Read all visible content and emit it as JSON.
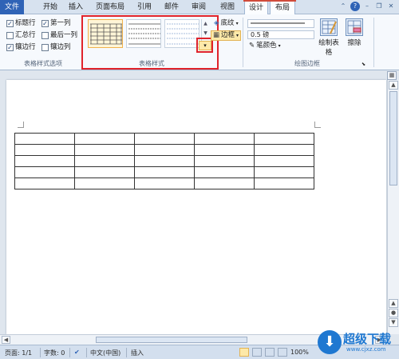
{
  "tabs": [
    {
      "label": "文件"
    },
    {
      "label": "开始"
    },
    {
      "label": "插入"
    },
    {
      "label": "页面布局"
    },
    {
      "label": "引用"
    },
    {
      "label": "邮件"
    },
    {
      "label": "审阅"
    },
    {
      "label": "视图"
    },
    {
      "label": "设计"
    },
    {
      "label": "布局"
    }
  ],
  "ribbon": {
    "style_options": {
      "items": [
        {
          "label": "标题行",
          "checked": true
        },
        {
          "label": "第一列",
          "checked": true
        },
        {
          "label": "汇总行",
          "checked": false
        },
        {
          "label": "最后一列",
          "checked": false
        },
        {
          "label": "镶边行",
          "checked": true
        },
        {
          "label": "镶边列",
          "checked": false
        }
      ],
      "group_label": "表格样式选项"
    },
    "table_styles": {
      "group_label": "表格样式",
      "more_glyph": "▾"
    },
    "shading_label": "底纹",
    "borders_label": "边框",
    "line_weight": "0.5 磅",
    "pen_color_label": "笔颜色",
    "draw_table_label": "绘制表格",
    "eraser_label": "擦除",
    "draw_borders_group_label": "绘图边框"
  },
  "status": {
    "page": "页面: 1/1",
    "words": "字数: 0",
    "language": "中文(中国)",
    "mode": "插入",
    "zoom": "100%"
  },
  "watermark": {
    "title": "超级下载",
    "url": "www.cjxz.com"
  },
  "colors": {
    "file_tab": "#2f63b6",
    "highlight": "#e0232b",
    "accent": "#1f78d1"
  }
}
